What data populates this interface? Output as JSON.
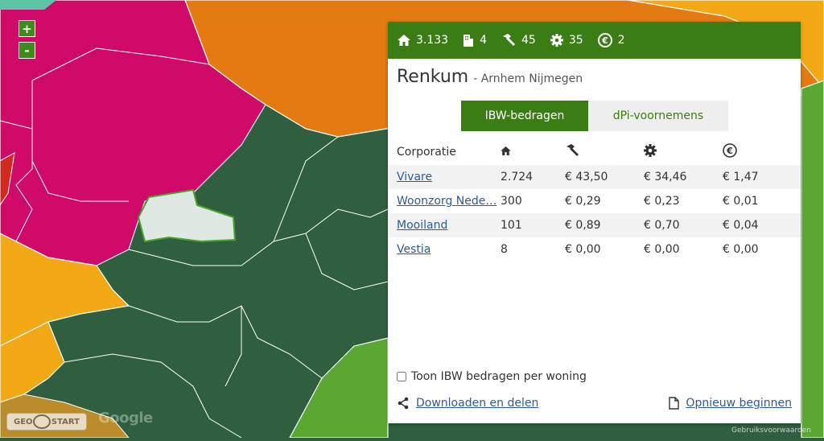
{
  "map": {
    "zoom_in": "+",
    "zoom_out": "-",
    "brand": "GEO",
    "brand2": "START",
    "google": "Google",
    "terms": "Gebruiksvoorwaarden",
    "colors": {
      "dark_green": "#2f5f3e",
      "green": "#5aa832",
      "orange": "#e47a12",
      "yellow_orange": "#f3a816",
      "magenta": "#cf0a69",
      "selected": "#dfe8e3"
    }
  },
  "panel": {
    "stats": [
      {
        "icon": "home-icon",
        "value": "3.133"
      },
      {
        "icon": "building-icon",
        "value": "4"
      },
      {
        "icon": "hammer-icon",
        "value": "45"
      },
      {
        "icon": "gear-icon",
        "value": "35"
      },
      {
        "icon": "euro-icon",
        "value": "2"
      }
    ],
    "title": "Renkum",
    "subtitle": "- Arnhem Nijmegen",
    "tabs": [
      "IBW-bedragen",
      "dPi-voornemens"
    ],
    "table": {
      "header": "Corporatie",
      "rows": [
        {
          "name": "Vivare",
          "homes": "2.724",
          "hammer": "€ 43,50",
          "gear": "€ 34,46",
          "euro": "€ 1,47"
        },
        {
          "name": "Woonzorg Nede…",
          "homes": "300",
          "hammer": "€ 0,29",
          "gear": "€ 0,23",
          "euro": "€ 0,01"
        },
        {
          "name": "Mooiland",
          "homes": "101",
          "hammer": "€ 0,89",
          "gear": "€ 0,70",
          "euro": "€ 0,04"
        },
        {
          "name": "Vestia",
          "homes": "8",
          "hammer": "€ 0,00",
          "gear": "€ 0,00",
          "euro": "€ 0,00"
        }
      ]
    },
    "checkbox_label": "Toon IBW bedragen per woning",
    "download_label": "Downloaden en delen",
    "restart_label": "Opnieuw beginnen",
    "accent": "#3b7d15",
    "link_color": "#2f5a94"
  }
}
